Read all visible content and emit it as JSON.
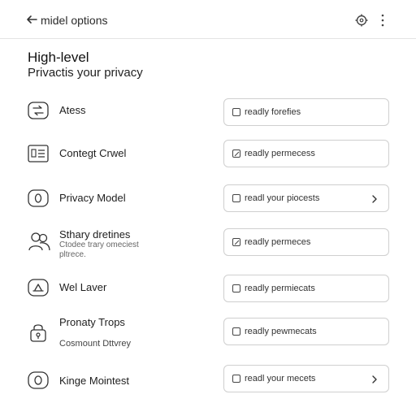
{
  "header": {
    "back_icon": "arrow-left-icon",
    "title": "midel options",
    "settings_icon": "settings-icon",
    "menu_icon": "more-vertical-icon"
  },
  "section": {
    "title": "High-level",
    "subtitle": "Privactis your privacy"
  },
  "rows": [
    {
      "icon": "transfer-icon",
      "label": "Atess",
      "description": "",
      "subtext": "",
      "field_text": "readly forefies",
      "checked": false,
      "chevron": false
    },
    {
      "icon": "document-list-icon",
      "label": "Contegt Crwel",
      "description": "",
      "subtext": "",
      "field_text": "readly permecess",
      "checked": true,
      "chevron": false
    },
    {
      "icon": "privacy-circle-icon",
      "label": "Privacy Model",
      "description": "",
      "subtext": "",
      "field_text": "readl your piocests",
      "checked": false,
      "chevron": true
    },
    {
      "icon": "users-icon",
      "label": "Sthary dretines",
      "description": "Ctodee trary omeciest pltrece.",
      "subtext": "",
      "field_text": "readly permeces",
      "checked": true,
      "chevron": false
    },
    {
      "icon": "level-icon",
      "label": "Wel Laver",
      "description": "",
      "subtext": "",
      "field_text": "readly permiecats",
      "checked": false,
      "chevron": false
    },
    {
      "icon": "lock-icon",
      "label": "Pronaty Trops",
      "description": "",
      "subtext": "Cosmount Dttvrey",
      "field_text": "readly pewmecats",
      "checked": false,
      "chevron": false
    },
    {
      "icon": "circle-dot-icon",
      "label": "Kinge Mointest",
      "description": "",
      "subtext": "",
      "field_text": "readl your mecets",
      "checked": false,
      "chevron": true
    }
  ]
}
